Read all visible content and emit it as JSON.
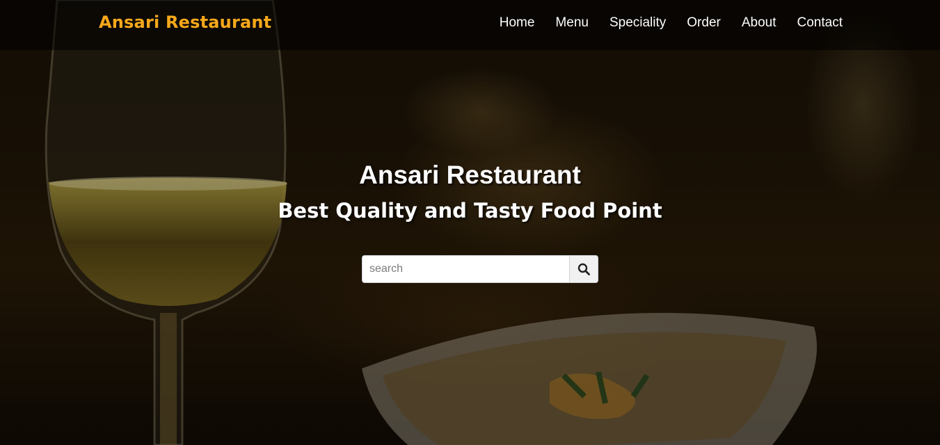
{
  "navbar": {
    "brand": "Ansari Restaurant",
    "items": [
      {
        "label": "Home"
      },
      {
        "label": "Menu"
      },
      {
        "label": "Speciality"
      },
      {
        "label": "Order"
      },
      {
        "label": "About"
      },
      {
        "label": "Contact"
      }
    ]
  },
  "hero": {
    "title": "Ansari Restaurant",
    "subtitle": "Best Quality and Tasty Food Point",
    "search": {
      "placeholder": "search",
      "value": "",
      "icon": "search-icon"
    }
  },
  "colors": {
    "brand": "#f7a81b",
    "nav_text": "#ffffff",
    "navbar_bg": "rgba(0,0,0,0.55)"
  }
}
